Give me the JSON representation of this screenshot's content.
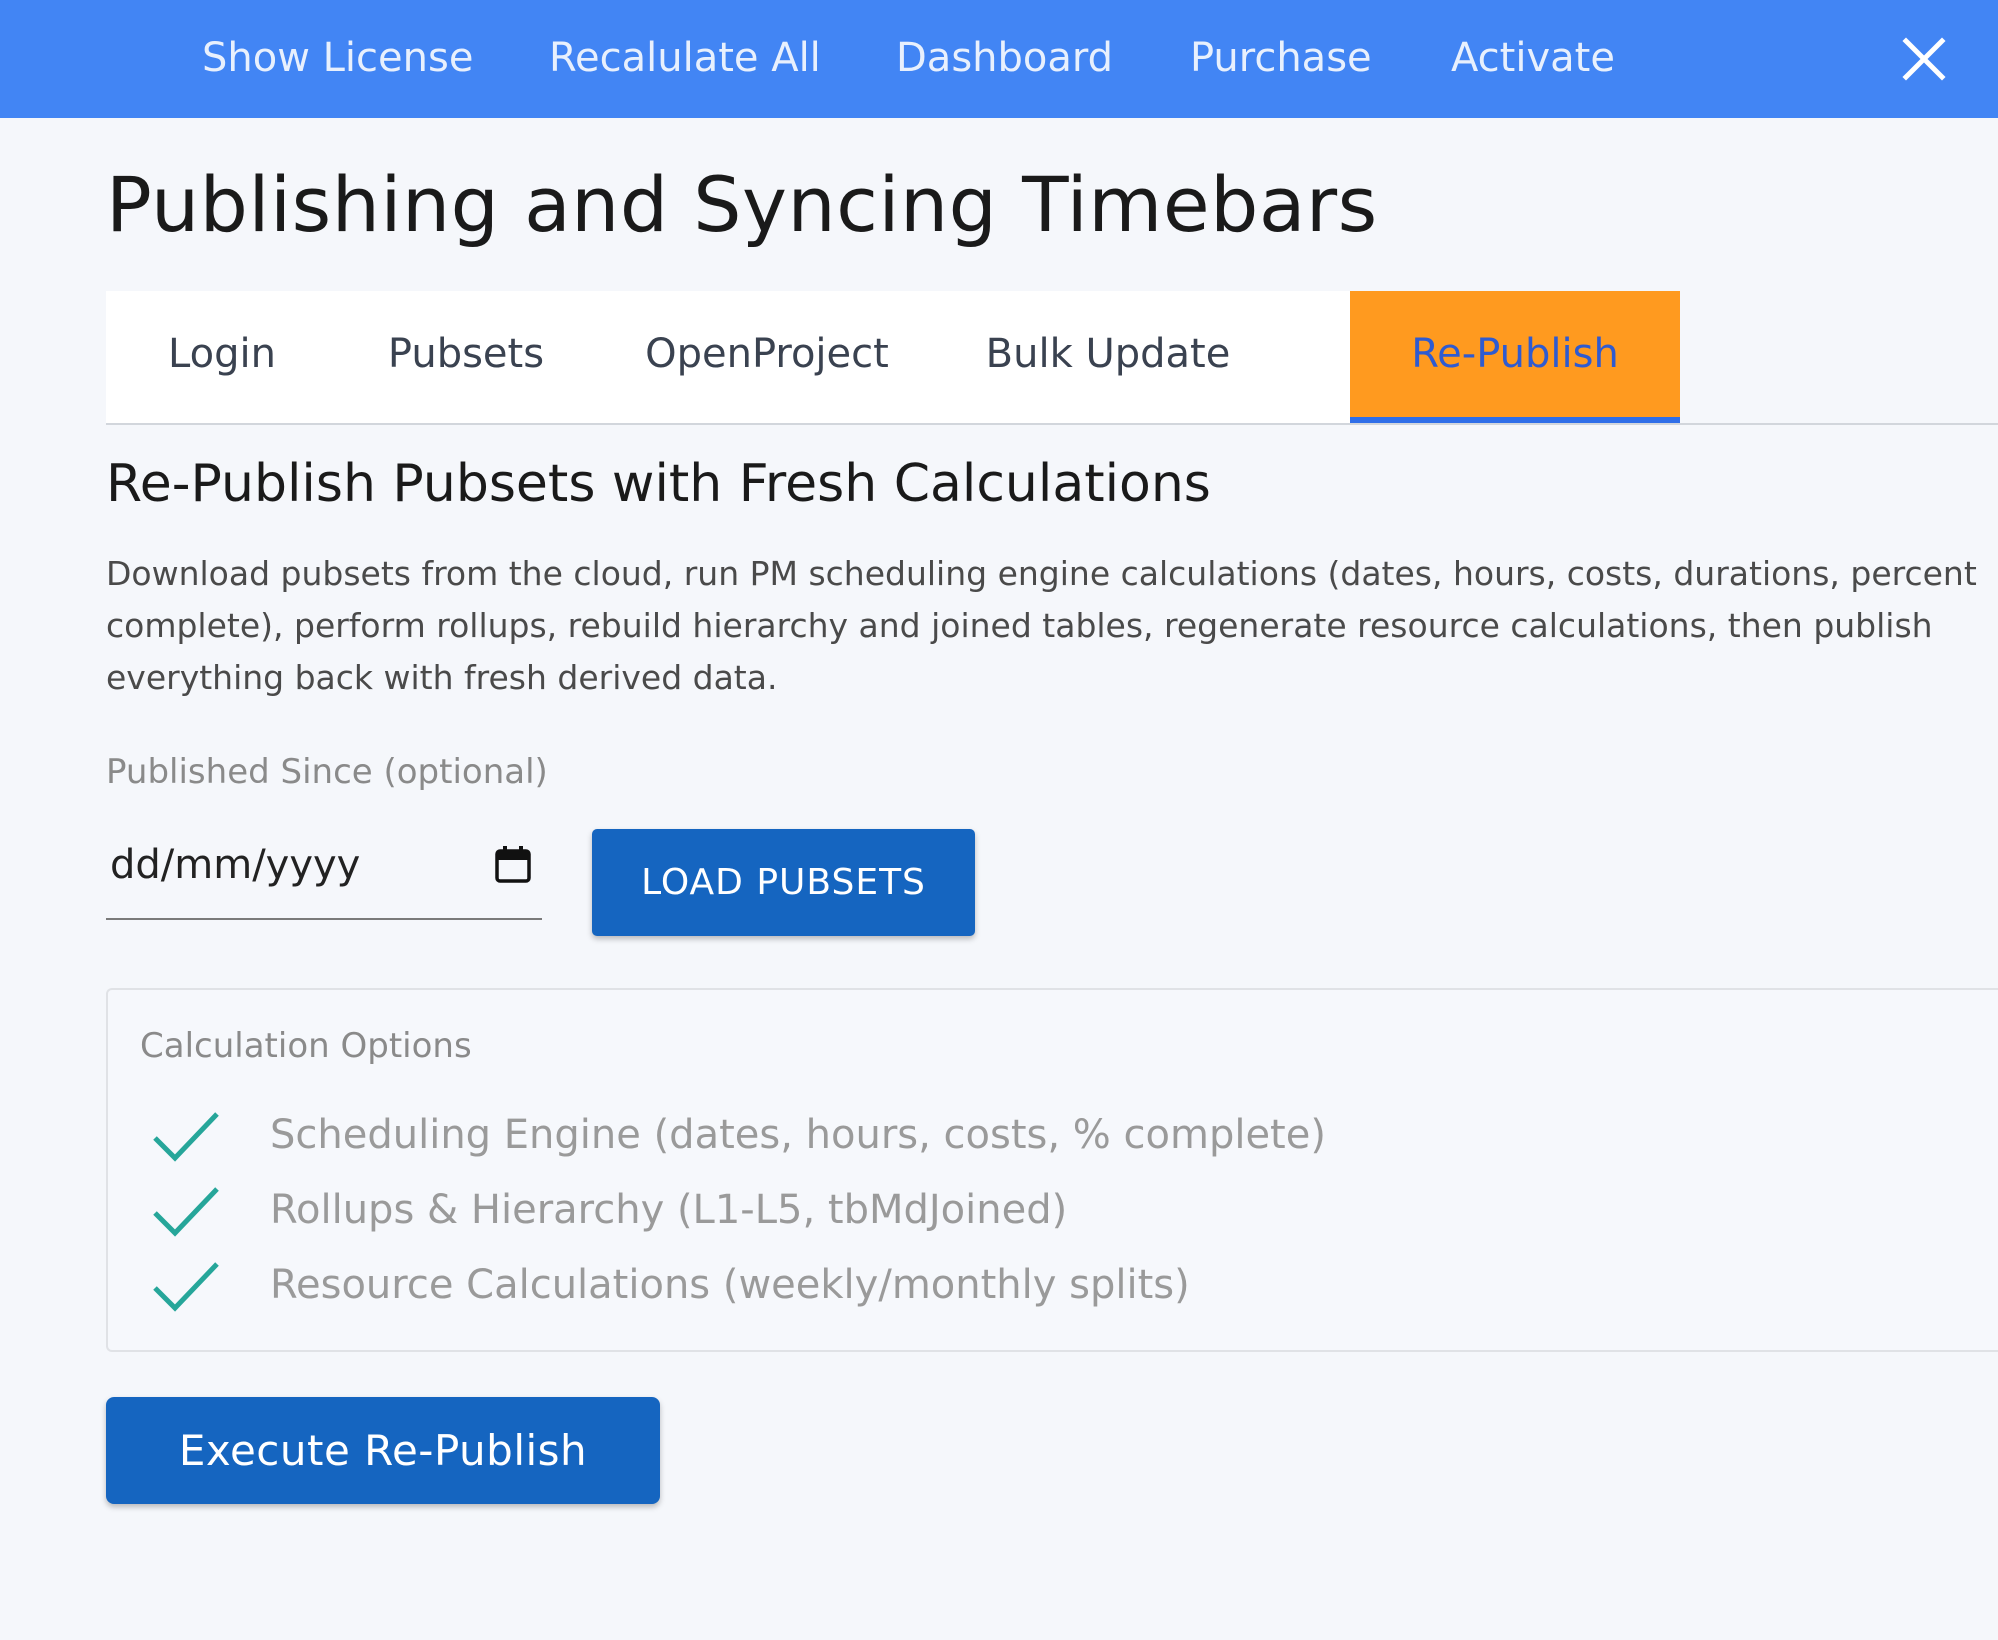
{
  "topnav": {
    "items": [
      {
        "label": "Show License"
      },
      {
        "label": "Recalulate All"
      },
      {
        "label": "Dashboard"
      },
      {
        "label": "Purchase"
      },
      {
        "label": "Activate"
      }
    ],
    "close_icon": "close-icon"
  },
  "page": {
    "title": "Publishing and Syncing Timebars"
  },
  "tabs": [
    {
      "label": "Login",
      "active": false
    },
    {
      "label": "Pubsets",
      "active": false
    },
    {
      "label": "OpenProject",
      "active": false
    },
    {
      "label": "Bulk Update",
      "active": false
    },
    {
      "label": "Re-Publish",
      "active": true
    }
  ],
  "republish": {
    "heading": "Re-Publish Pubsets with Fresh Calculations",
    "description": "Download pubsets from the cloud, run PM scheduling engine calculations (dates, hours, costs, durations, percent complete), perform rollups, rebuild hierarchy and joined tables, regenerate resource calculations, then publish everything back with fresh derived data.",
    "published_since": {
      "label": "Published Since (optional)",
      "placeholder": "dd/mm/yyyy",
      "value": ""
    },
    "load_button": "LOAD PUBSETS",
    "options": {
      "title": "Calculation Options",
      "items": [
        {
          "label": "Scheduling Engine (dates, hours, costs, % complete)",
          "checked": true
        },
        {
          "label": "Rollups & Hierarchy (L1-L5, tbMdJoined)",
          "checked": true
        },
        {
          "label": "Resource Calculations (weekly/monthly splits)",
          "checked": true
        }
      ]
    },
    "execute_button": "Execute Re-Publish"
  },
  "colors": {
    "topbar": "#4285f4",
    "active_tab": "#ff9a1f",
    "active_tab_text": "#2f5bd0",
    "primary_button": "#1565c0",
    "check": "#26a69a"
  }
}
